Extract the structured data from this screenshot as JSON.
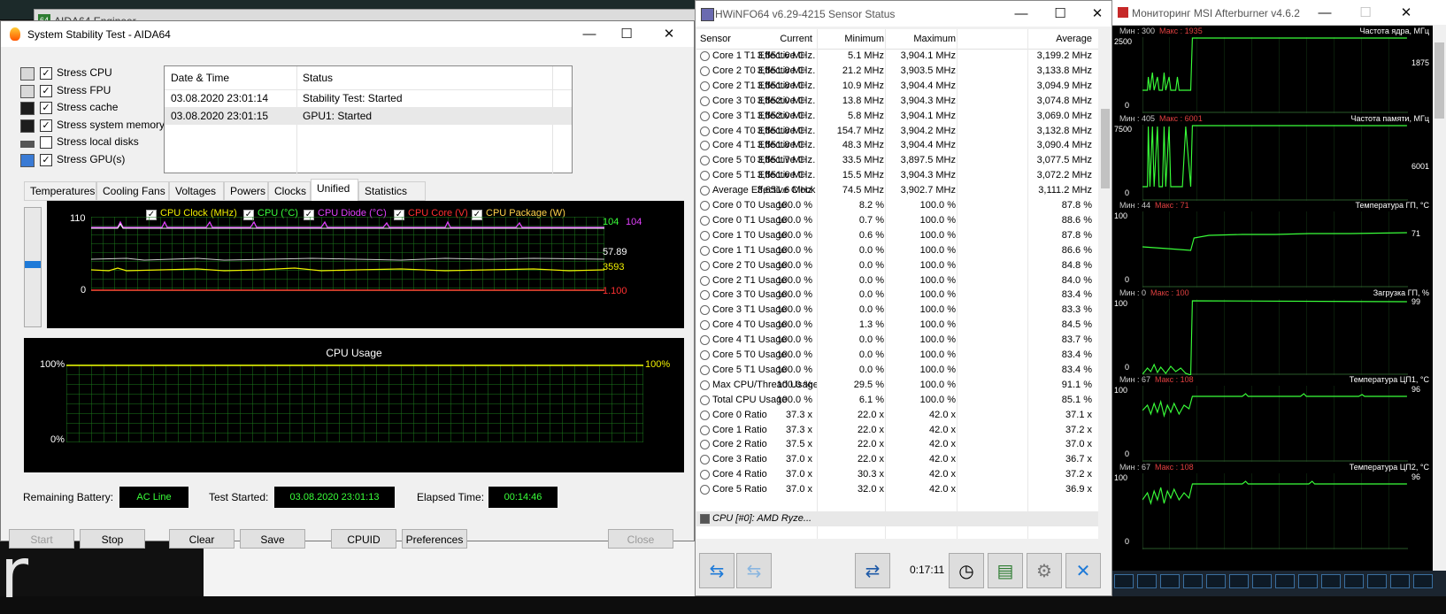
{
  "background": {
    "aida_main_title": "AIDA64 Engineer",
    "desktop_text": "r"
  },
  "aida": {
    "title": "System Stability Test - AIDA64",
    "stress_items": [
      {
        "label": "Stress CPU",
        "checked": true,
        "icon": "cpu-icon"
      },
      {
        "label": "Stress FPU",
        "checked": true,
        "icon": "fpu-icon"
      },
      {
        "label": "Stress cache",
        "checked": true,
        "icon": "cache-icon"
      },
      {
        "label": "Stress system memory",
        "checked": true,
        "icon": "memory-icon"
      },
      {
        "label": "Stress local disks",
        "checked": false,
        "icon": "disk-icon"
      },
      {
        "label": "Stress GPU(s)",
        "checked": true,
        "icon": "gpu-icon"
      }
    ],
    "log": {
      "headers": [
        "Date & Time",
        "Status"
      ],
      "rows": [
        {
          "time": "03.08.2020 23:01:14",
          "status": "Stability Test: Started"
        },
        {
          "time": "03.08.2020 23:01:15",
          "status": "GPU1: Started"
        }
      ]
    },
    "tabs": [
      "Temperatures",
      "Cooling Fans",
      "Voltages",
      "Powers",
      "Clocks",
      "Unified",
      "Statistics"
    ],
    "active_tab": "Unified",
    "graph1": {
      "legend": [
        {
          "label": "CPU Clock (MHz)",
          "color": "#f0f000"
        },
        {
          "label": "CPU (°C)",
          "color": "#39ff39"
        },
        {
          "label": "CPU Diode (°C)",
          "color": "#e040fb"
        },
        {
          "label": "CPU Core (V)",
          "color": "#ff3030"
        },
        {
          "label": "CPU Package (W)",
          "color": "#ffd24a"
        }
      ],
      "y_top": "110",
      "y_bottom": "0",
      "values": {
        "cpu_temp": "104",
        "diode_temp": "104",
        "package": "57.89",
        "clock": "3593",
        "core_v": "1.100"
      }
    },
    "graph2": {
      "title": "CPU Usage",
      "y_top": "100%",
      "y_bottom": "0%",
      "value": "100%"
    },
    "status": {
      "battery_label": "Remaining Battery:",
      "battery": "AC Line",
      "started_label": "Test Started:",
      "started": "03.08.2020 23:01:13",
      "elapsed_label": "Elapsed Time:",
      "elapsed": "00:14:46"
    },
    "buttons": {
      "start": "Start",
      "stop": "Stop",
      "clear": "Clear",
      "save": "Save",
      "cpuid": "CPUID",
      "preferences": "Preferences",
      "close": "Close"
    }
  },
  "hwinfo": {
    "title": "HWiNFO64 v6.29-4215 Sensor Status",
    "headers": [
      "Sensor",
      "Current",
      "Minimum",
      "Maximum",
      "Average"
    ],
    "rows": [
      [
        "Core 1 T1 Effective Cl...",
        "3,651.6 MHz",
        "5.1 MHz",
        "3,904.1 MHz",
        "3,199.2 MHz"
      ],
      [
        "Core 2 T0 Effective Cl...",
        "3,651.8 MHz",
        "21.2 MHz",
        "3,903.5 MHz",
        "3,133.8 MHz"
      ],
      [
        "Core 2 T1 Effective Cl...",
        "3,651.8 MHz",
        "10.9 MHz",
        "3,904.4 MHz",
        "3,094.9 MHz"
      ],
      [
        "Core 3 T0 Effective Cl...",
        "3,652.0 MHz",
        "13.8 MHz",
        "3,904.3 MHz",
        "3,074.8 MHz"
      ],
      [
        "Core 3 T1 Effective Cl...",
        "3,652.0 MHz",
        "5.8 MHz",
        "3,904.1 MHz",
        "3,069.0 MHz"
      ],
      [
        "Core 4 T0 Effective Cl...",
        "3,651.8 MHz",
        "154.7 MHz",
        "3,904.2 MHz",
        "3,132.8 MHz"
      ],
      [
        "Core 4 T1 Effective Cl...",
        "3,651.8 MHz",
        "48.3 MHz",
        "3,904.4 MHz",
        "3,090.4 MHz"
      ],
      [
        "Core 5 T0 Effective Cl...",
        "3,651.7 MHz",
        "33.5 MHz",
        "3,897.5 MHz",
        "3,077.5 MHz"
      ],
      [
        "Core 5 T1 Effective Cl...",
        "3,651.6 MHz",
        "15.5 MHz",
        "3,904.3 MHz",
        "3,072.2 MHz"
      ],
      [
        "Average Effective Clock",
        "3,651.6 MHz",
        "74.5 MHz",
        "3,902.7 MHz",
        "3,111.2 MHz"
      ],
      [
        "Core 0 T0 Usage",
        "100.0 %",
        "8.2 %",
        "100.0 %",
        "87.8 %"
      ],
      [
        "Core 0 T1 Usage",
        "100.0 %",
        "0.7 %",
        "100.0 %",
        "88.6 %"
      ],
      [
        "Core 1 T0 Usage",
        "100.0 %",
        "0.6 %",
        "100.0 %",
        "87.8 %"
      ],
      [
        "Core 1 T1 Usage",
        "100.0 %",
        "0.0 %",
        "100.0 %",
        "86.6 %"
      ],
      [
        "Core 2 T0 Usage",
        "100.0 %",
        "0.0 %",
        "100.0 %",
        "84.8 %"
      ],
      [
        "Core 2 T1 Usage",
        "100.0 %",
        "0.0 %",
        "100.0 %",
        "84.0 %"
      ],
      [
        "Core 3 T0 Usage",
        "100.0 %",
        "0.0 %",
        "100.0 %",
        "83.4 %"
      ],
      [
        "Core 3 T1 Usage",
        "100.0 %",
        "0.0 %",
        "100.0 %",
        "83.3 %"
      ],
      [
        "Core 4 T0 Usage",
        "100.0 %",
        "1.3 %",
        "100.0 %",
        "84.5 %"
      ],
      [
        "Core 4 T1 Usage",
        "100.0 %",
        "0.0 %",
        "100.0 %",
        "83.7 %"
      ],
      [
        "Core 5 T0 Usage",
        "100.0 %",
        "0.0 %",
        "100.0 %",
        "83.4 %"
      ],
      [
        "Core 5 T1 Usage",
        "100.0 %",
        "0.0 %",
        "100.0 %",
        "83.4 %"
      ],
      [
        "Max CPU/Thread Usage",
        "100.0 %",
        "29.5 %",
        "100.0 %",
        "91.1 %"
      ],
      [
        "Total CPU Usage",
        "100.0 %",
        "6.1 %",
        "100.0 %",
        "85.1 %"
      ],
      [
        "Core 0 Ratio",
        "37.3 x",
        "22.0 x",
        "42.0 x",
        "37.1 x"
      ],
      [
        "Core 1 Ratio",
        "37.3 x",
        "22.0 x",
        "42.0 x",
        "37.2 x"
      ],
      [
        "Core 2 Ratio",
        "37.5 x",
        "22.0 x",
        "42.0 x",
        "37.0 x"
      ],
      [
        "Core 3 Ratio",
        "37.0 x",
        "22.0 x",
        "42.0 x",
        "36.7 x"
      ],
      [
        "Core 4 Ratio",
        "37.0 x",
        "30.3 x",
        "42.0 x",
        "37.2 x"
      ],
      [
        "Core 5 Ratio",
        "37.0 x",
        "32.0 x",
        "42.0 x",
        "36.9 x"
      ]
    ],
    "group_row": "CPU [#0]: AMD Ryze...",
    "timer": "0:17:11"
  },
  "msi": {
    "title": "Мониторинг MSI Afterburner v4.6.2",
    "graphs": [
      {
        "name": "Частота ядра, МГц",
        "min": "Мин : 300",
        "max": "Макс : 1935",
        "scale_top": "2500",
        "scale_bottom": "0",
        "value": "1875"
      },
      {
        "name": "Частота памяти, МГц",
        "min": "Мин : 405",
        "max": "Макс : 6001",
        "scale_top": "7500",
        "scale_bottom": "0",
        "value": "6001"
      },
      {
        "name": "Температура ГП, °С",
        "min": "Мин : 44",
        "max": "Макс : 71",
        "scale_top": "100",
        "scale_bottom": "0",
        "value": "71"
      },
      {
        "name": "Загрузка ГП, %",
        "min": "Мин : 0",
        "max": "Макс : 100",
        "scale_top": "100",
        "scale_bottom": "0",
        "value": "99"
      },
      {
        "name": "Температура ЦП1, °С",
        "min": "Мин : 67",
        "max": "Макс : 108",
        "scale_top": "100",
        "scale_bottom": "0",
        "value": "96"
      },
      {
        "name": "Температура ЦП2, °С",
        "min": "Мин : 67",
        "max": "Макс : 108",
        "scale_top": "100",
        "scale_bottom": "0",
        "value": "96"
      }
    ]
  }
}
